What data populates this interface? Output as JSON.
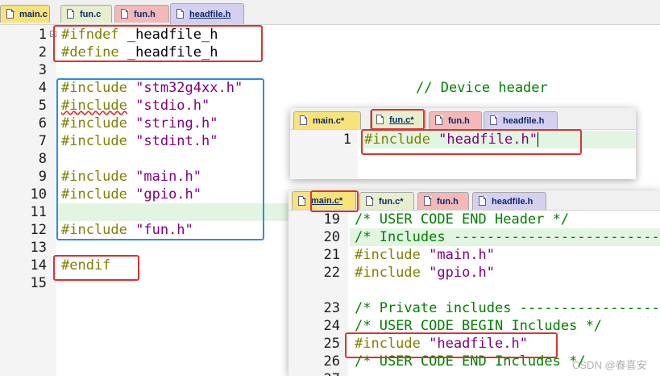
{
  "main_editor": {
    "tabs": [
      {
        "label": "main.c",
        "color": "#f8e27a"
      },
      {
        "label": "fun.c",
        "color": "#e6eecc"
      },
      {
        "label": "fun.h",
        "color": "#f4b8b8"
      },
      {
        "label": "headfile.h",
        "color": "#d6d0f0"
      }
    ],
    "line_numbers": [
      "1",
      "2",
      "3",
      "4",
      "5",
      "6",
      "7",
      "8",
      "9",
      "10",
      "11",
      "12",
      "13",
      "14",
      "15"
    ],
    "lines": {
      "l1_kw": "#ifndef",
      "l1_id": " _headfile_h",
      "l2_kw": "#define",
      "l2_id": " _headfile_h",
      "l4_kw": "#include",
      "l4_str": " \"stm32g4xx.h\"",
      "l4_cmt": "// Device header",
      "l5_kw": "#include",
      "l5_str": " \"stdio.h\"",
      "l6_kw": "#include",
      "l6_str": " \"string.h\"",
      "l7_kw": "#include",
      "l7_str": " \"stdint.h\"",
      "l9_kw": "#include",
      "l9_str": " \"main.h\"",
      "l10_kw": "#include",
      "l10_str": " \"gpio.h\"",
      "l12_kw": "#include",
      "l12_str": " \"fun.h\"",
      "l14_kw": "#endif"
    }
  },
  "popup_fun": {
    "tabs": [
      {
        "label": "main.c*",
        "color": "#f8e27a"
      },
      {
        "label": "fun.c*",
        "color": "#e6eecc"
      },
      {
        "label": "fun.h",
        "color": "#f4b8b8"
      },
      {
        "label": "headfile.h",
        "color": "#d6d0f0"
      }
    ],
    "line_number": "1",
    "line_kw": "#include",
    "line_str": " \"headfile.h\""
  },
  "popup_main": {
    "tabs": [
      {
        "label": "main.c*",
        "color": "#f8e27a"
      },
      {
        "label": "fun.c*",
        "color": "#e6eecc"
      },
      {
        "label": "fun.h",
        "color": "#f4b8b8"
      },
      {
        "label": "headfile.h",
        "color": "#d6d0f0"
      }
    ],
    "line_numbers": [
      "19",
      "20",
      "21",
      "22",
      "23",
      "24",
      "25",
      "26",
      "27"
    ],
    "lines": {
      "l19": "/* USER CODE END Header */",
      "l20": "/* Includes ----------------------------",
      "l21_kw": "#include",
      "l21_str": " \"main.h\"",
      "l22_kw": "#include",
      "l22_str": " \"gpio.h\"",
      "l24": "/* Private includes -----------------",
      "l25": "/* USER CODE BEGIN Includes */",
      "l26_kw": "#include",
      "l26_str": " \"headfile.h\"",
      "l27": "/* USER CODE END Includes */"
    }
  },
  "watermark": "CSDN @春喜安"
}
